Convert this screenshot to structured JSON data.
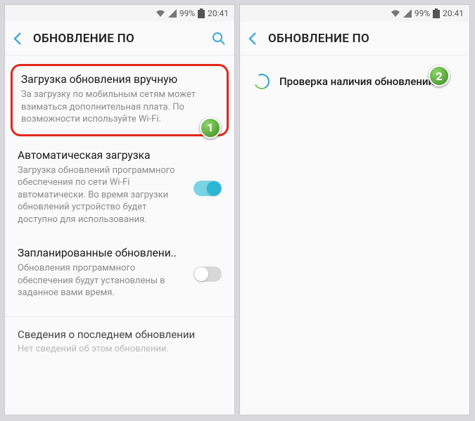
{
  "status": {
    "battery_pct": "99%",
    "time": "20:41"
  },
  "left": {
    "header": "ОБНОВЛЕНИЕ ПО",
    "callout": "1",
    "opt1": {
      "title": "Загрузка обновления вручную",
      "desc": "За загрузку по мобильным сетям может взиматься дополнительная плата. По возможности используйте Wi-Fi."
    },
    "opt2": {
      "title": "Автоматическая загрузка",
      "desc": "Загрузка обновлений программного обеспечения по сети Wi-Fi автоматически. Во время загрузки обновлений устройство будет доступно для использования."
    },
    "opt3": {
      "title": "Запланированные обновлени..",
      "desc": "Обновления программного обеспечения будут установлены в заданное вами время."
    },
    "footer": {
      "title": "Сведения о последнем обновлении",
      "desc": "Нет сведений об этом обновлении."
    }
  },
  "right": {
    "header": "ОБНОВЛЕНИЕ ПО",
    "callout": "2",
    "checking": "Проверка наличия обновлений..."
  }
}
